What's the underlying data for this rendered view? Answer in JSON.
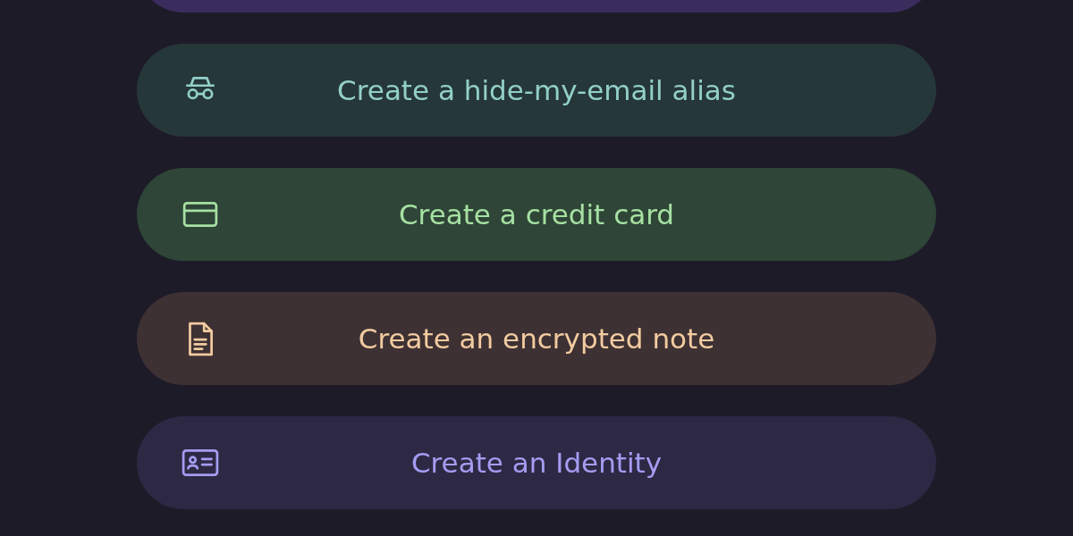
{
  "buttons": [
    {
      "kind": "partial",
      "color": "#3a2d5e"
    },
    {
      "kind": "alias",
      "label": "Create a hide-my-email alias",
      "color": "#263739"
    },
    {
      "kind": "card",
      "label": "Create a credit card",
      "color": "#2e4537"
    },
    {
      "kind": "note",
      "label": "Create an encrypted note",
      "color": "#3e3133"
    },
    {
      "kind": "identity",
      "label": "Create an Identity",
      "color": "#2d2944"
    }
  ]
}
